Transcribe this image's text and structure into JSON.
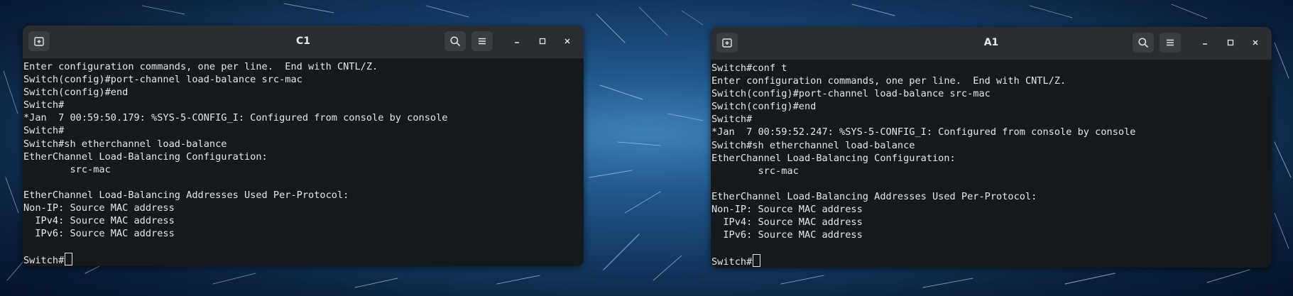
{
  "windows": [
    {
      "title": "C1",
      "lines": [
        "Enter configuration commands, one per line.  End with CNTL/Z.",
        "Switch(config)#port-channel load-balance src-mac",
        "Switch(config)#end",
        "Switch#",
        "*Jan  7 00:59:50.179: %SYS-5-CONFIG_I: Configured from console by console",
        "Switch#",
        "Switch#sh etherchannel load-balance",
        "EtherChannel Load-Balancing Configuration:",
        "        src-mac",
        "",
        "EtherChannel Load-Balancing Addresses Used Per-Protocol:",
        "Non-IP: Source MAC address",
        "  IPv4: Source MAC address",
        "  IPv6: Source MAC address",
        "",
        "Switch#"
      ]
    },
    {
      "title": "A1",
      "lines": [
        "Switch#conf t",
        "Enter configuration commands, one per line.  End with CNTL/Z.",
        "Switch(config)#port-channel load-balance src-mac",
        "Switch(config)#end",
        "Switch#",
        "*Jan  7 00:59:52.247: %SYS-5-CONFIG_I: Configured from console by console",
        "Switch#sh etherchannel load-balance",
        "EtherChannel Load-Balancing Configuration:",
        "        src-mac",
        "",
        "EtherChannel Load-Balancing Addresses Used Per-Protocol:",
        "Non-IP: Source MAC address",
        "  IPv4: Source MAC address",
        "  IPv6: Source MAC address",
        "",
        "Switch#"
      ]
    }
  ],
  "icons": {
    "new_tab": "new-tab-icon",
    "search": "search-icon",
    "menu": "hamburger-menu-icon",
    "minimize": "minimize-icon",
    "maximize": "maximize-icon",
    "close": "close-icon"
  },
  "colors": {
    "terminal_bg": "#16191c",
    "headerbar_bg": "#2a2d31",
    "text": "#e6e6e6",
    "desktop_accent": "#3d7fb8"
  }
}
